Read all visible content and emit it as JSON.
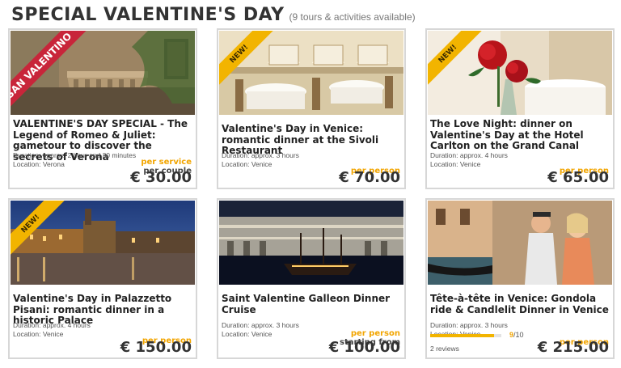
{
  "header": {
    "title": "SPECIAL VALENTINE'S DAY",
    "subtitle": "(9 tours & activities available)"
  },
  "colors": {
    "accent": "#f2a500",
    "ribbon_yellow": "#f2b400",
    "ribbon_red": "#c8253a",
    "border": "#d7d7d7"
  },
  "cards": [
    {
      "title": "VALENTINE'S DAY SPECIAL - The Legend of Romeo & Juliet: gametour to discover the secrets of Verona",
      "ribbon": "SAN VALENTINO",
      "duration": "Duration: approx. 2 hour and 30 minutes",
      "location": "Location: Verona",
      "price_type": "per service",
      "price_extra": "per couple",
      "price": "€ 30.00",
      "image": "verona-balcony"
    },
    {
      "title": "Valentine's Day in Venice: romantic dinner at the Sivoli Restaurant",
      "ribbon": "NEW!",
      "duration": "Duration: approx. 3 hours",
      "location": "Location: Venice",
      "price_type": "per person",
      "price": "€ 70.00",
      "image": "restaurant-interior"
    },
    {
      "title": "The Love Night: dinner on Valentine's Day at the Hotel Carlton on the Grand Canal",
      "ribbon": "NEW!",
      "duration": "Duration: approx. 4 hours",
      "location": "Location: Venice",
      "price_type": "per person",
      "price": "€ 65.00",
      "image": "red-roses"
    },
    {
      "title": "Valentine's Day in Palazzetto Pisani: romantic dinner in a historic Palace",
      "ribbon": "NEW!",
      "duration": "Duration: approx. 4 hours",
      "location": "Location: Venice",
      "price_type": "per person",
      "price": "€ 150.00",
      "image": "grand-canal-night"
    },
    {
      "title": "Saint Valentine Galleon Dinner Cruise",
      "duration": "Duration: approx. 3 hours",
      "location": "Location: Venice",
      "price_type": "per person",
      "price_extra": "starting from",
      "price": "€ 100.00",
      "image": "galleon-night"
    },
    {
      "title": "Tête-à-tête in Venice: Gondola ride & Candlelit Dinner in Venice",
      "duration": "Duration: approx. 3 hours",
      "location": "Location: Venice",
      "price_type": "per person",
      "price": "€ 215.00",
      "rating": {
        "value": 9,
        "max": 10,
        "score_prefix": "9",
        "score_suffix": "/10"
      },
      "reviews": "2 reviews",
      "image": "gondola-couple"
    }
  ]
}
